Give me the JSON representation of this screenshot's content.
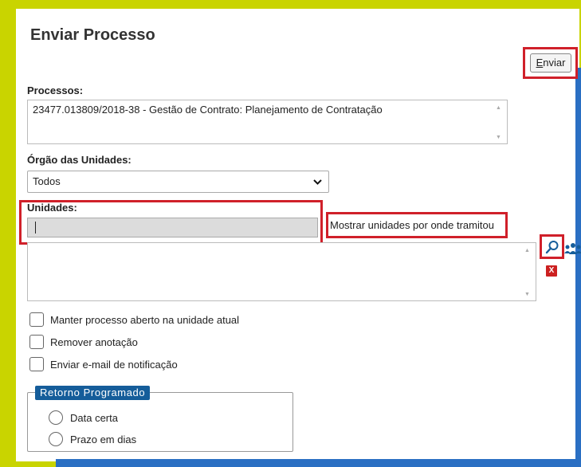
{
  "page": {
    "title": "Enviar Processo"
  },
  "toolbar": {
    "send_label_rest": "nviar",
    "send_label_access": "E"
  },
  "processos": {
    "label": "Processos:",
    "value": "23477.013809/2018-38 - Gestão de Contrato: Planejamento de Contratação"
  },
  "orgao": {
    "label": "Órgão das Unidades:",
    "selected": "Todos"
  },
  "unidades": {
    "label": "Unidades:",
    "input_value": "",
    "show_link": "Mostrar unidades por onde tramitou"
  },
  "options": [
    {
      "label": "Manter processo aberto na unidade atual"
    },
    {
      "label": "Remover anotação"
    },
    {
      "label": "Enviar e-mail de notificação"
    }
  ],
  "retorno": {
    "legend": "Retorno Programado",
    "options": [
      {
        "label": "Data certa"
      },
      {
        "label": "Prazo em dias"
      }
    ]
  },
  "icons": {
    "search": "search-icon",
    "people": "people-icon",
    "remove": "remove-x-icon",
    "remove_glyph": "X"
  },
  "colors": {
    "frame": "#c9d400",
    "accent_blue": "#155d9a",
    "highlight_red": "#d0202a"
  }
}
